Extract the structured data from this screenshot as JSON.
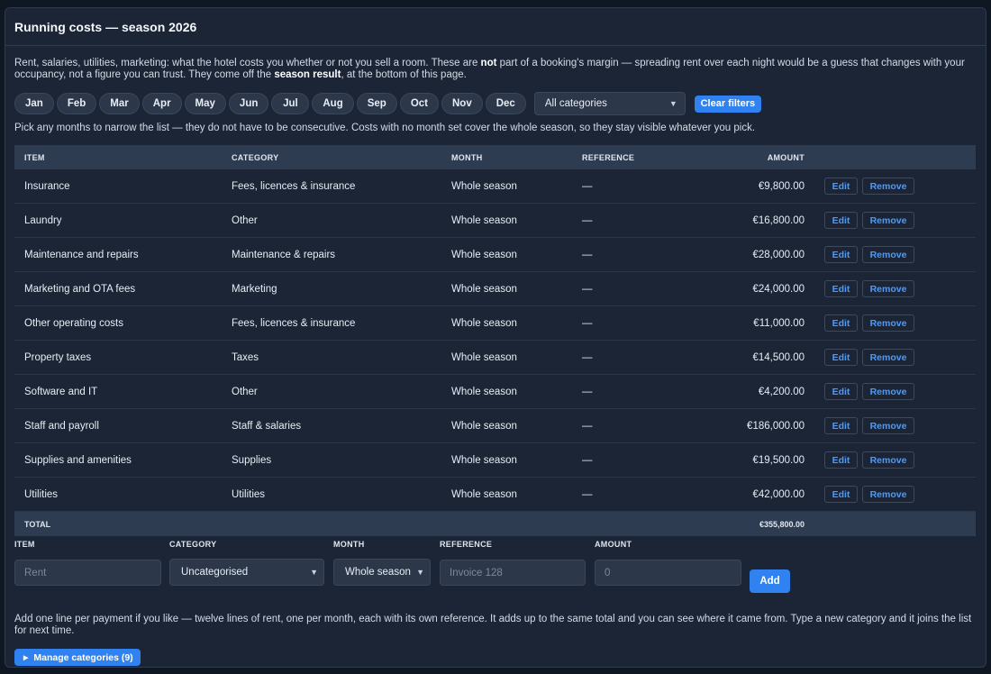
{
  "header": {
    "title": "Running costs — season 2026"
  },
  "intro": {
    "p1": "Rent, salaries, utilities, marketing: what the hotel costs you whether or not you sell a room. These are ",
    "b1": "not",
    "p2": " part of a booking's margin — spreading rent over each night would be a guess that changes with your occupancy, not a figure you can trust. They come off the ",
    "b2": "season result",
    "p3": ", at the bottom of this page."
  },
  "filters": {
    "months": [
      "Jan",
      "Feb",
      "Mar",
      "Apr",
      "May",
      "Jun",
      "Jul",
      "Aug",
      "Sep",
      "Oct",
      "Nov",
      "Dec"
    ],
    "category_selected": "All categories",
    "clear_label": "Clear filters",
    "hint": "Pick any months to narrow the list — they do not have to be consecutive. Costs with no month set cover the whole season, so they stay visible whatever you pick."
  },
  "table": {
    "headers": {
      "item": "ITEM",
      "category": "CATEGORY",
      "month": "MONTH",
      "reference": "REFERENCE",
      "amount": "AMOUNT"
    },
    "rows": [
      {
        "item": "Insurance",
        "category": "Fees, licences & insurance",
        "month": "Whole season",
        "reference": "—",
        "amount": "€9,800.00"
      },
      {
        "item": "Laundry",
        "category": "Other",
        "month": "Whole season",
        "reference": "—",
        "amount": "€16,800.00"
      },
      {
        "item": "Maintenance and repairs",
        "category": "Maintenance & repairs",
        "month": "Whole season",
        "reference": "—",
        "amount": "€28,000.00"
      },
      {
        "item": "Marketing and OTA fees",
        "category": "Marketing",
        "month": "Whole season",
        "reference": "—",
        "amount": "€24,000.00"
      },
      {
        "item": "Other operating costs",
        "category": "Fees, licences & insurance",
        "month": "Whole season",
        "reference": "—",
        "amount": "€11,000.00"
      },
      {
        "item": "Property taxes",
        "category": "Taxes",
        "month": "Whole season",
        "reference": "—",
        "amount": "€14,500.00"
      },
      {
        "item": "Software and IT",
        "category": "Other",
        "month": "Whole season",
        "reference": "—",
        "amount": "€4,200.00"
      },
      {
        "item": "Staff and payroll",
        "category": "Staff & salaries",
        "month": "Whole season",
        "reference": "—",
        "amount": "€186,000.00"
      },
      {
        "item": "Supplies and amenities",
        "category": "Supplies",
        "month": "Whole season",
        "reference": "—",
        "amount": "€19,500.00"
      },
      {
        "item": "Utilities",
        "category": "Utilities",
        "month": "Whole season",
        "reference": "—",
        "amount": "€42,000.00"
      }
    ],
    "edit_label": "Edit",
    "remove_label": "Remove",
    "total_label": "TOTAL",
    "total_amount": "€355,800.00"
  },
  "add_form": {
    "item_label": "ITEM",
    "item_placeholder": "Rent",
    "category_label": "CATEGORY",
    "category_value": "Uncategorised",
    "month_label": "MONTH",
    "month_value": "Whole season",
    "reference_label": "REFERENCE",
    "reference_placeholder": "Invoice 128",
    "amount_label": "AMOUNT",
    "amount_placeholder": "0",
    "add_label": "Add"
  },
  "footer": {
    "note": "Add one line per payment if you like — twelve lines of rent, one per month, each with its own reference. It adds up to the same total and you can see where it came from. Type a new category and it joins the list for next time.",
    "manage_label": "Manage categories (9)"
  },
  "colors": {
    "accent": "#2f82f0",
    "link": "#4b9bff",
    "panel": "#1b2535",
    "table_header": "#2e3c52"
  },
  "icons": {
    "select_chevron": "chevron-down-icon",
    "disclosure": "triangle-right-icon"
  }
}
